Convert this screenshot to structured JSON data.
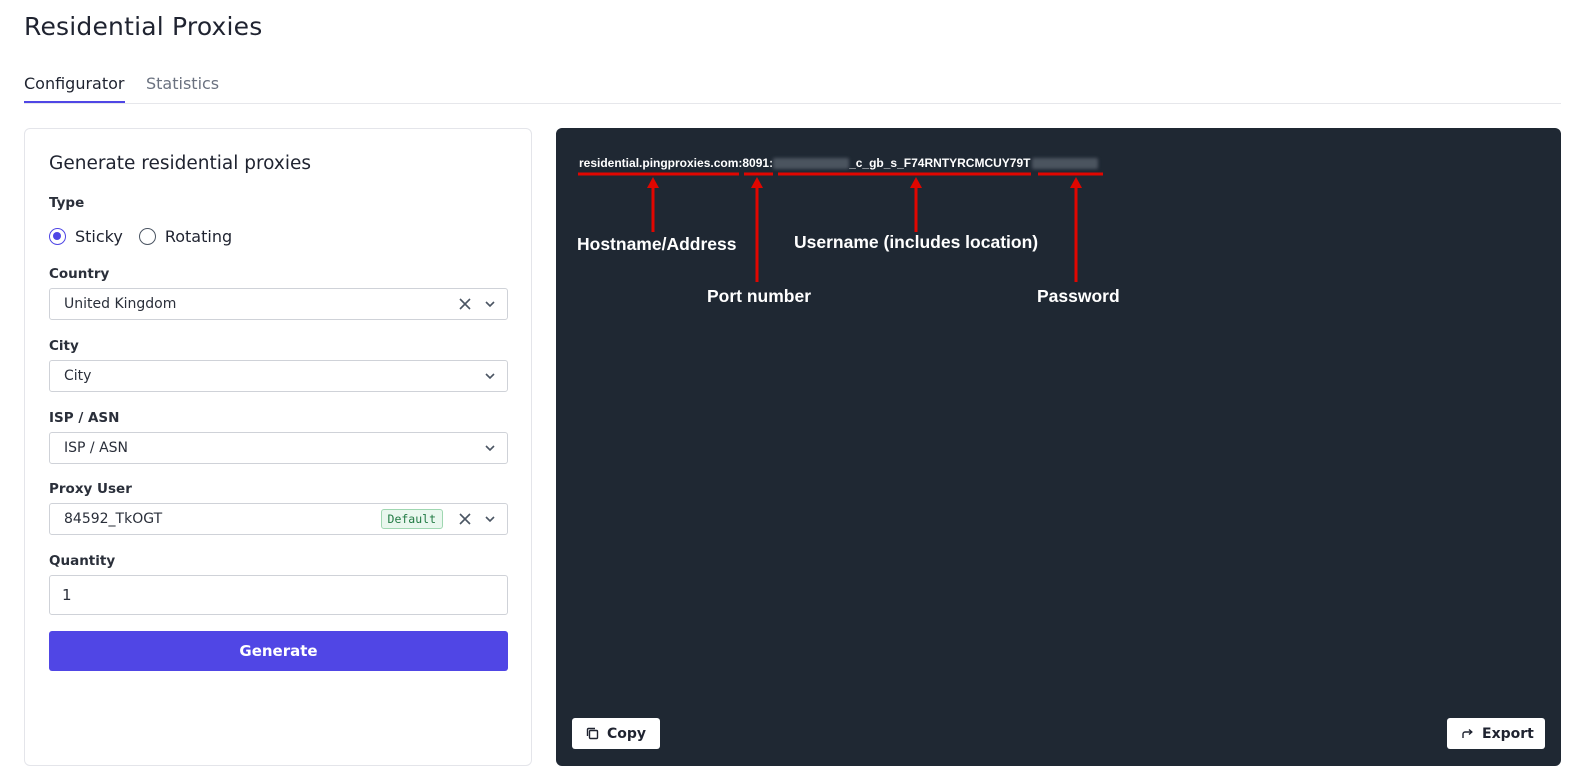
{
  "page": {
    "title": "Residential Proxies"
  },
  "tabs": [
    {
      "label": "Configurator",
      "active": true
    },
    {
      "label": "Statistics",
      "active": false
    }
  ],
  "form": {
    "title": "Generate residential proxies",
    "type": {
      "label": "Type",
      "options": [
        "Sticky",
        "Rotating"
      ],
      "selected": "Sticky"
    },
    "country": {
      "label": "Country",
      "value": "United Kingdom"
    },
    "city": {
      "label": "City",
      "placeholder": "City"
    },
    "isp": {
      "label": "ISP / ASN",
      "placeholder": "ISP / ASN"
    },
    "proxy_user": {
      "label": "Proxy User",
      "value": "84592_TkOGT",
      "badge": "Default"
    },
    "quantity": {
      "label": "Quantity",
      "value": "1"
    },
    "generate_label": "Generate"
  },
  "output": {
    "proxy_host": "residential.pingproxies.com:",
    "proxy_port": "8091:",
    "proxy_user_suffix": "_c_gb_s_F74RNTYRCMCUY79T",
    "annotations": {
      "hostname": "Hostname/Address",
      "port": "Port number",
      "username": "Username (includes location)",
      "password": "Password"
    },
    "copy_label": "Copy",
    "export_label": "Export"
  },
  "colors": {
    "accent": "#5046e5",
    "output_bg": "#1f2833",
    "annotation": "#e10600"
  }
}
